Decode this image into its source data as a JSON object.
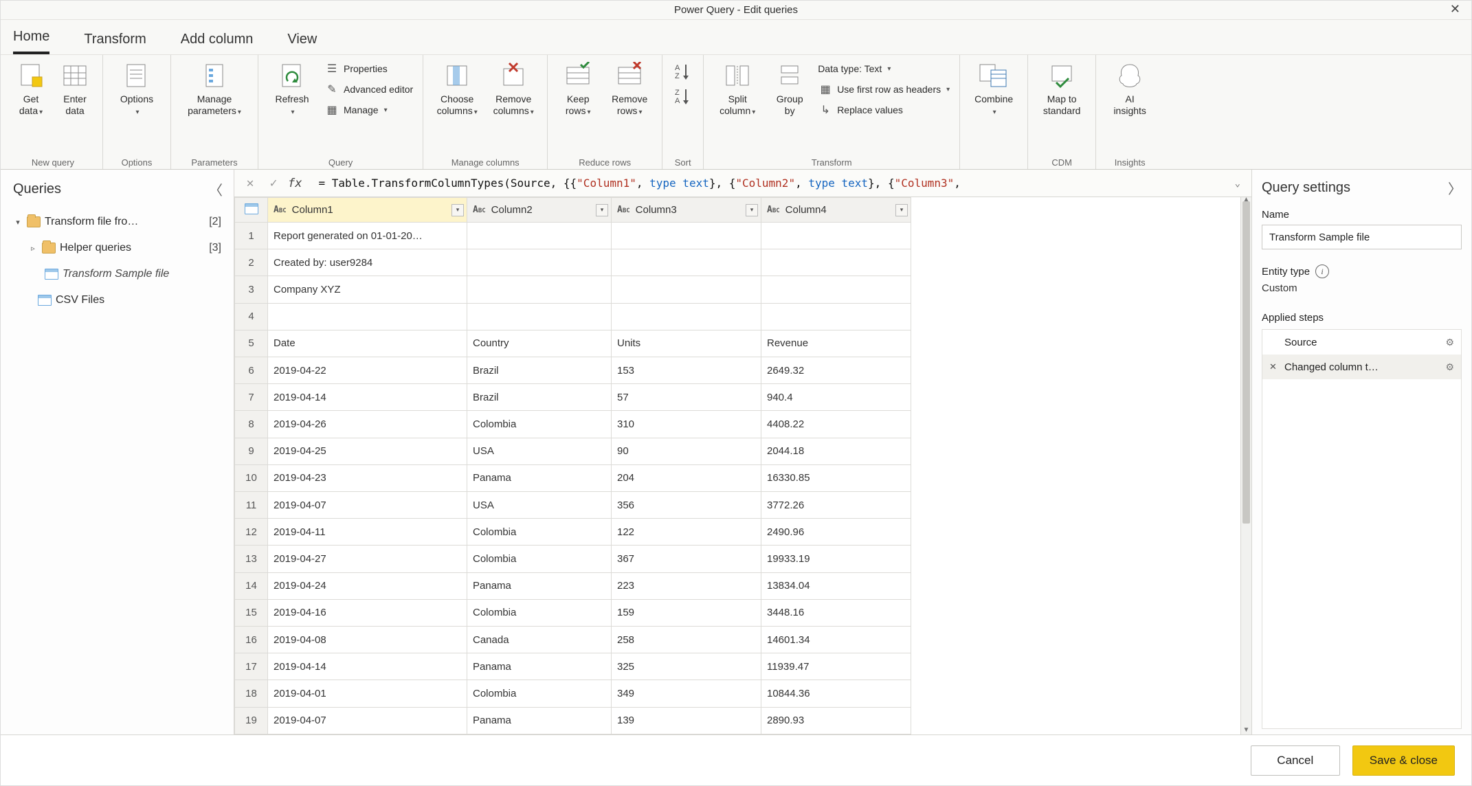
{
  "window": {
    "title": "Power Query - Edit queries"
  },
  "tabs": {
    "home": "Home",
    "transform": "Transform",
    "addColumn": "Add column",
    "view": "View"
  },
  "ribbon": {
    "newQuery": {
      "getData": "Get\ndata",
      "enterData": "Enter\ndata",
      "label": "New query"
    },
    "options": {
      "options": "Options",
      "label": "Options"
    },
    "parameters": {
      "manage": "Manage\nparameters",
      "label": "Parameters"
    },
    "query": {
      "refresh": "Refresh",
      "properties": "Properties",
      "advanced": "Advanced editor",
      "manage": "Manage",
      "label": "Query"
    },
    "manageCols": {
      "choose": "Choose\ncolumns",
      "remove": "Remove\ncolumns",
      "label": "Manage columns"
    },
    "reduceRows": {
      "keep": "Keep\nrows",
      "remove": "Remove\nrows",
      "label": "Reduce rows"
    },
    "sort": {
      "label": "Sort"
    },
    "transform": {
      "split": "Split\ncolumn",
      "groupBy": "Group\nby",
      "dataType": "Data type: Text",
      "firstRow": "Use first row as headers",
      "replace": "Replace values",
      "label": "Transform"
    },
    "combine": {
      "combine": "Combine",
      "label": ""
    },
    "cdm": {
      "map": "Map to\nstandard",
      "label": "CDM"
    },
    "insights": {
      "ai": "AI\ninsights",
      "label": "Insights"
    }
  },
  "queriesPane": {
    "title": "Queries",
    "items": {
      "transformFile": {
        "label": "Transform file fro…",
        "count": "[2]"
      },
      "helper": {
        "label": "Helper queries",
        "count": "[3]"
      },
      "sample": {
        "label": "Transform Sample file"
      },
      "csv": {
        "label": "CSV Files"
      }
    }
  },
  "formula": {
    "prefix": "= Table.TransformColumnTypes(Source, {{",
    "c1": "\"Column1\"",
    "kw1": "type text",
    "mid1": "}, {",
    "c2": "\"Column2\"",
    "kw2": "type text",
    "mid2": "}, {",
    "c3": "\"Column3\"",
    "suffix": ","
  },
  "grid": {
    "columns": [
      "Column1",
      "Column2",
      "Column3",
      "Column4"
    ],
    "rows": [
      {
        "n": "1",
        "c": [
          "Report generated on 01-01-20…",
          "",
          "",
          ""
        ]
      },
      {
        "n": "2",
        "c": [
          "Created by: user9284",
          "",
          "",
          ""
        ]
      },
      {
        "n": "3",
        "c": [
          "Company XYZ",
          "",
          "",
          ""
        ]
      },
      {
        "n": "4",
        "c": [
          "",
          "",
          "",
          ""
        ]
      },
      {
        "n": "5",
        "c": [
          "Date",
          "Country",
          "Units",
          "Revenue"
        ]
      },
      {
        "n": "6",
        "c": [
          "2019-04-22",
          "Brazil",
          "153",
          "2649.32"
        ]
      },
      {
        "n": "7",
        "c": [
          "2019-04-14",
          "Brazil",
          "57",
          "940.4"
        ]
      },
      {
        "n": "8",
        "c": [
          "2019-04-26",
          "Colombia",
          "310",
          "4408.22"
        ]
      },
      {
        "n": "9",
        "c": [
          "2019-04-25",
          "USA",
          "90",
          "2044.18"
        ]
      },
      {
        "n": "10",
        "c": [
          "2019-04-23",
          "Panama",
          "204",
          "16330.85"
        ]
      },
      {
        "n": "11",
        "c": [
          "2019-04-07",
          "USA",
          "356",
          "3772.26"
        ]
      },
      {
        "n": "12",
        "c": [
          "2019-04-11",
          "Colombia",
          "122",
          "2490.96"
        ]
      },
      {
        "n": "13",
        "c": [
          "2019-04-27",
          "Colombia",
          "367",
          "19933.19"
        ]
      },
      {
        "n": "14",
        "c": [
          "2019-04-24",
          "Panama",
          "223",
          "13834.04"
        ]
      },
      {
        "n": "15",
        "c": [
          "2019-04-16",
          "Colombia",
          "159",
          "3448.16"
        ]
      },
      {
        "n": "16",
        "c": [
          "2019-04-08",
          "Canada",
          "258",
          "14601.34"
        ]
      },
      {
        "n": "17",
        "c": [
          "2019-04-14",
          "Panama",
          "325",
          "11939.47"
        ]
      },
      {
        "n": "18",
        "c": [
          "2019-04-01",
          "Colombia",
          "349",
          "10844.36"
        ]
      },
      {
        "n": "19",
        "c": [
          "2019-04-07",
          "Panama",
          "139",
          "2890.93"
        ]
      }
    ]
  },
  "settings": {
    "title": "Query settings",
    "nameLabel": "Name",
    "nameValue": "Transform Sample file",
    "entityLabel": "Entity type",
    "entityValue": "Custom",
    "stepsLabel": "Applied steps",
    "steps": [
      {
        "name": "Source"
      },
      {
        "name": "Changed column t…"
      }
    ]
  },
  "footer": {
    "cancel": "Cancel",
    "save": "Save & close"
  }
}
